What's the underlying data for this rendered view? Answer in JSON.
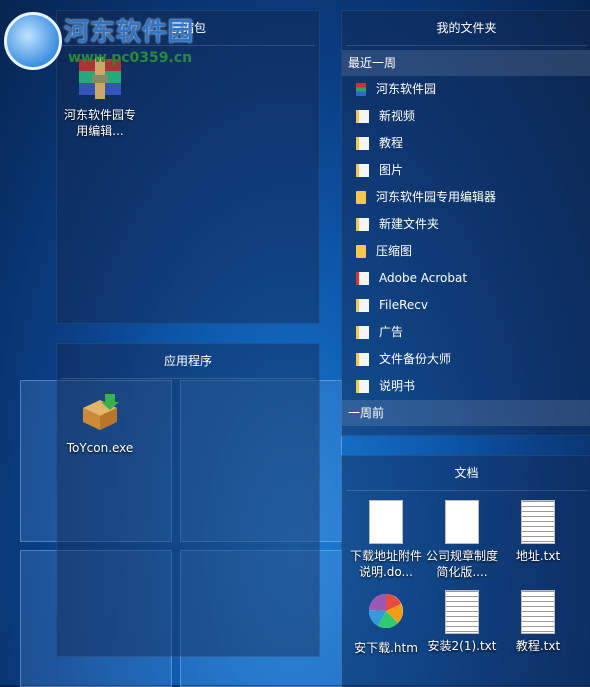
{
  "watermark": {
    "title": "河东软件园",
    "url": "www.pc0359.cn"
  },
  "fence_compress": {
    "title": "压缩包",
    "icons": [
      {
        "label": "河东软件园专用编辑...",
        "icon": "winrar-archive-icon"
      }
    ]
  },
  "fence_apps": {
    "title": "应用程序",
    "icons": [
      {
        "label": "ToYcon.exe",
        "icon": "installer-box-icon"
      }
    ]
  },
  "fence_folders": {
    "title": "我的文件夹",
    "recent_header": "最近一周",
    "items": [
      {
        "label": "河东软件园",
        "icon": "zip-file-icon"
      },
      {
        "label": "新视频",
        "icon": "folder-doc-icon"
      },
      {
        "label": "教程",
        "icon": "folder-doc-icon"
      },
      {
        "label": "图片",
        "icon": "folder-doc-icon"
      },
      {
        "label": "河东软件园专用编辑器",
        "icon": "folder-icon"
      },
      {
        "label": "新建文件夹",
        "icon": "folder-doc-icon"
      },
      {
        "label": "压缩图",
        "icon": "folder-icon"
      },
      {
        "label": "Adobe Acrobat",
        "icon": "pdf-folder-icon"
      },
      {
        "label": "FileRecv",
        "icon": "folder-doc-icon"
      },
      {
        "label": "广告",
        "icon": "folder-doc-icon"
      },
      {
        "label": "文件备份大师",
        "icon": "folder-doc-icon"
      },
      {
        "label": "说明书",
        "icon": "folder-doc-icon"
      }
    ],
    "week_header": "一周前"
  },
  "fence_docs": {
    "title": "文档",
    "files": [
      {
        "label": "下载地址附件说明.do...",
        "icon": "doc-file-icon"
      },
      {
        "label": "公司规章制度简化版....",
        "icon": "doc-file-icon"
      },
      {
        "label": "地址.txt",
        "icon": "txt-file-icon"
      },
      {
        "label": "安下载.htm",
        "icon": "htm-file-icon"
      },
      {
        "label": "安装2(1).txt",
        "icon": "txt-file-icon"
      },
      {
        "label": "教程.txt",
        "icon": "txt-file-icon"
      }
    ]
  }
}
